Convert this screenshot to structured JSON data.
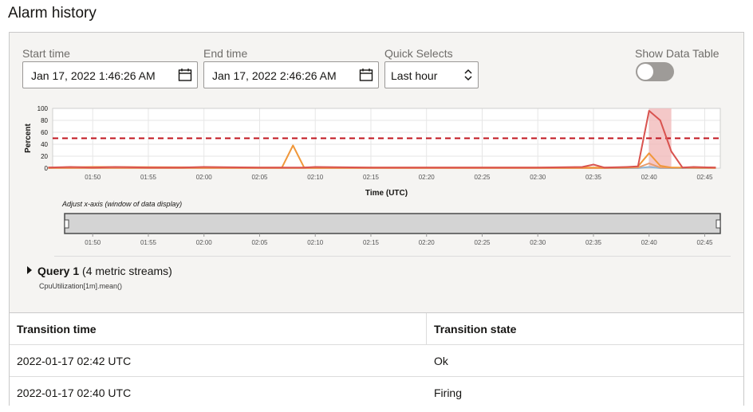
{
  "page": {
    "title": "Alarm history"
  },
  "controls": {
    "start_time_label": "Start time",
    "start_time_value": "Jan 17, 2022 1:46:26 AM",
    "end_time_label": "End time",
    "end_time_value": "Jan 17, 2022 2:46:26 AM",
    "quick_selects_label": "Quick Selects",
    "quick_selects_value": "Last hour",
    "show_data_table_label": "Show Data Table",
    "show_data_table_on": false
  },
  "chart_data": {
    "type": "line",
    "ylabel": "Percent",
    "xlabel": "Time (UTC)",
    "yticks": [
      0,
      20,
      40,
      60,
      80,
      100
    ],
    "ylim": [
      0,
      100
    ],
    "xlim_minutes": [
      46.4,
      106.4
    ],
    "x_ticks": [
      "01:50",
      "01:55",
      "02:00",
      "02:05",
      "02:10",
      "02:15",
      "02:20",
      "02:25",
      "02:30",
      "02:35",
      "02:40",
      "02:45"
    ],
    "threshold": 50,
    "threshold_color": "#c0141e",
    "firing_window": [
      "02:40",
      "02:42"
    ],
    "series": [
      {
        "color": "#d9534f",
        "x": [
          "01:46",
          "01:48",
          "01:50",
          "01:52",
          "01:55",
          "01:58",
          "02:00",
          "02:05",
          "02:09",
          "02:10",
          "02:15",
          "02:20",
          "02:25",
          "02:30",
          "02:34",
          "02:35",
          "02:36",
          "02:38",
          "02:39",
          "02:40",
          "02:41",
          "02:42",
          "02:43",
          "02:44",
          "02:46"
        ],
        "y": [
          1,
          2,
          1,
          2,
          1,
          1,
          2,
          1,
          1,
          2,
          1,
          1,
          1,
          1,
          2,
          6,
          1,
          2,
          3,
          96,
          80,
          28,
          1,
          2,
          1
        ]
      },
      {
        "color": "#f0973a",
        "x": [
          "01:46",
          "01:50",
          "02:05",
          "02:07",
          "02:08",
          "02:09",
          "02:10",
          "02:20",
          "02:38",
          "02:39",
          "02:40",
          "02:41",
          "02:42",
          "02:46"
        ],
        "y": [
          1,
          2,
          1,
          1,
          38,
          1,
          1,
          1,
          1,
          3,
          25,
          4,
          1,
          1
        ]
      },
      {
        "color": "#e89c6b",
        "x": [
          "01:46",
          "02:10",
          "02:36",
          "02:39",
          "02:40",
          "02:41",
          "02:46"
        ],
        "y": [
          0,
          0,
          0,
          1,
          8,
          1,
          0
        ]
      },
      {
        "color": "#8fb6d4",
        "x": [
          "01:46",
          "02:20",
          "02:39",
          "02:40",
          "02:41",
          "02:46"
        ],
        "y": [
          0,
          0,
          0,
          2,
          0,
          0
        ]
      }
    ],
    "navigator_label": "Adjust x-axis (window of data display)"
  },
  "query": {
    "name": "Query 1",
    "streams": "(4 metric streams)",
    "expression": "CpuUtilization[1m].mean()"
  },
  "table": {
    "headers": [
      "Transition time",
      "Transition state"
    ],
    "rows": [
      [
        "2022-01-17 02:42 UTC",
        "Ok"
      ],
      [
        "2022-01-17 02:40 UTC",
        "Firing"
      ]
    ]
  }
}
